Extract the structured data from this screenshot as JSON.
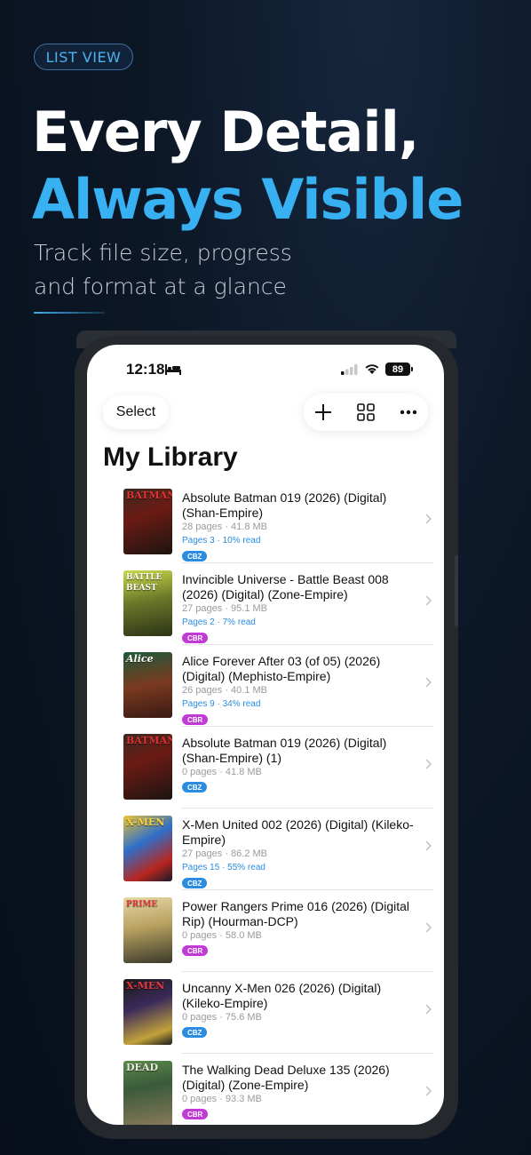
{
  "promo": {
    "badge": "LIST VIEW",
    "headline_line1": "Every Detail,",
    "headline_line2": "Always Visible",
    "subtitle_line1": "Track file size, progress",
    "subtitle_line2": "and format at a glance",
    "accent_color": "#38b1f3"
  },
  "status_bar": {
    "time": "12:18",
    "battery": "89"
  },
  "toolbar": {
    "select_label": "Select",
    "add_icon": "plus-icon",
    "grid_icon": "grid-icon",
    "more_icon": "ellipsis-icon"
  },
  "library": {
    "title": "My Library",
    "items": [
      {
        "title": "Absolute Batman 019 (2026) (Digital) (Shan-Empire)",
        "meta": "28 pages · 41.8 MB",
        "progress": "Pages 3 · 10% read",
        "format": "CBZ",
        "cover_text": "BATMAN"
      },
      {
        "title": "Invincible Universe - Battle Beast 008 (2026) (Digital) (Zone-Empire)",
        "meta": "27 pages · 95.1 MB",
        "progress": "Pages 2 · 7% read",
        "format": "CBR",
        "cover_text": "BATTLE BEAST"
      },
      {
        "title": "Alice Forever After 03 (of 05) (2026) (Digital) (Mephisto-Empire)",
        "meta": "26 pages · 40.1 MB",
        "progress": "Pages 9 · 34% read",
        "format": "CBR",
        "cover_text": "Alice"
      },
      {
        "title": "Absolute Batman 019 (2026) (Digital) (Shan-Empire) (1)",
        "meta": "0 pages · 41.8 MB",
        "progress": "",
        "format": "CBZ",
        "cover_text": "BATMAN"
      },
      {
        "title": "X-Men United 002 (2026) (Digital) (Kileko-Empire)",
        "meta": "27 pages · 86.2 MB",
        "progress": "Pages 15 · 55% read",
        "format": "CBZ",
        "cover_text": "X-MEN"
      },
      {
        "title": "Power Rangers Prime 016 (2026) (Digital Rip) (Hourman-DCP)",
        "meta": "0 pages · 58.0 MB",
        "progress": "",
        "format": "CBR",
        "cover_text": "PRIME"
      },
      {
        "title": "Uncanny X-Men 026 (2026) (Digital) (Kileko-Empire)",
        "meta": "0 pages · 75.6 MB",
        "progress": "",
        "format": "CBZ",
        "cover_text": "X-MEN"
      },
      {
        "title": "The Walking Dead Deluxe 135 (2026) (Digital) (Zone-Empire)",
        "meta": "0 pages · 93.3 MB",
        "progress": "",
        "format": "CBR",
        "cover_text": "DEAD"
      }
    ]
  },
  "colors": {
    "cbz_badge": "#2a8ce0",
    "cbr_badge": "#c23ad6",
    "progress_text": "#2a8ce0"
  }
}
